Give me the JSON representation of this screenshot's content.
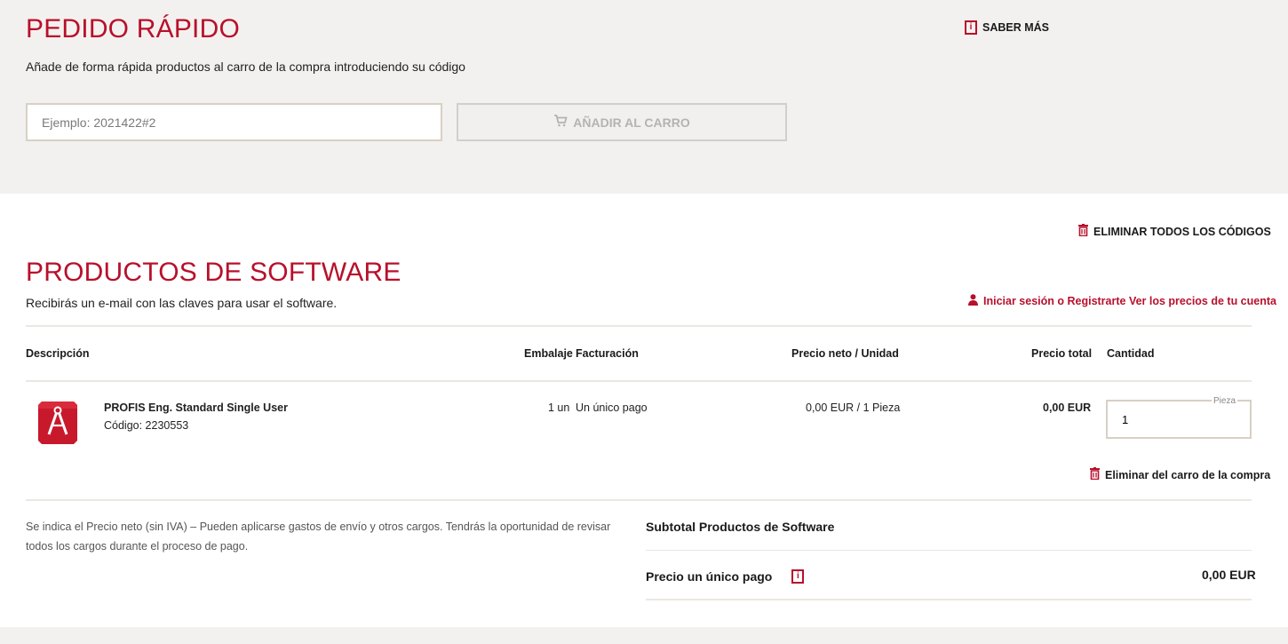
{
  "quick_order": {
    "title": "PEDIDO RÁPIDO",
    "subtitle": "Añade de forma rápida productos al carro de la compra introduciendo su código",
    "input_placeholder": "Ejemplo: 2021422#2",
    "add_button_label": "AÑADIR AL CARRO",
    "learn_more_label": "SABER MÁS"
  },
  "software": {
    "remove_all_label": "ELIMINAR TODOS LOS CÓDIGOS",
    "title": "PRODUCTOS DE SOFTWARE",
    "subtitle": "Recibirás un e-mail con las claves para usar el software.",
    "login_link": "Iniciar sesión o Registrarte Ver los precios de tu cuenta",
    "columns": {
      "description": "Descripción",
      "packaging": "Embalaje",
      "billing": "Facturación",
      "net_price": "Precio neto / Unidad",
      "total_price": "Precio total",
      "quantity": "Cantidad"
    },
    "items": [
      {
        "name": "PROFIS Eng. Standard Single User",
        "code": "Código: 2230553",
        "packaging": "1 un",
        "billing": "Un único pago",
        "net_price": "0,00 EUR / 1 Pieza",
        "total_price": "0,00 EUR",
        "quantity_label": "Pieza",
        "quantity_value": "1",
        "remove_label": "Eliminar del carro de la compra"
      }
    ],
    "note": "Se indica el Precio neto (sin IVA) – Pueden aplicarse gastos de envío y otros cargos. Tendrás la oportunidad de revisar todos los cargos durante el proceso de pago.",
    "subtotal_label": "Subtotal Productos de Software",
    "one_time_label": "Precio un único pago",
    "one_time_value": "0,00 EUR"
  },
  "colors": {
    "brand_red": "#b8102b",
    "panel_bg": "#f3f1ef",
    "border": "#d8d0c4"
  },
  "icons": [
    "info-icon",
    "cart-icon",
    "trash-icon",
    "user-icon",
    "compass-icon"
  ]
}
